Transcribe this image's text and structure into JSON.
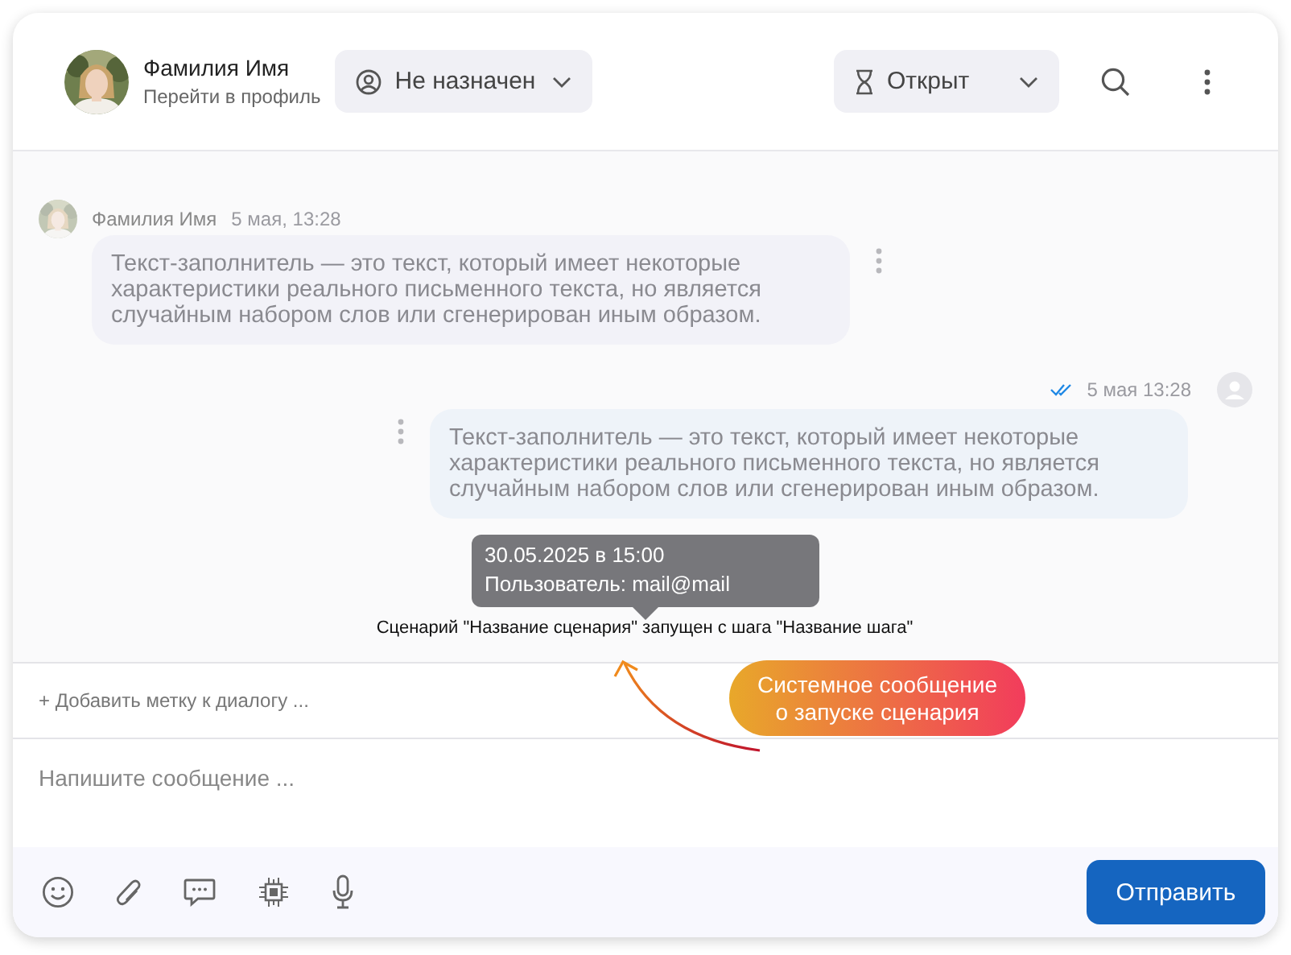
{
  "header": {
    "user_name": "Фамилия Имя",
    "profile_link": "Перейти в профиль",
    "assignee": {
      "label": "Не назначен"
    },
    "status": {
      "label": "Открыт"
    }
  },
  "messages": [
    {
      "kind": "incoming",
      "author": "Фамилия Имя",
      "time": "5 мая, 13:28",
      "text": "Текст-заполнитель — это текст, который имеет некоторые характеристики реального письменного текста, но является случайным набором слов или сгенерирован иным образом."
    },
    {
      "kind": "outgoing",
      "time": "5 мая 13:28",
      "read": true,
      "text": "Текст-заполнитель — это текст, который имеет некоторые характеристики реального письменного текста, но является случайным набором слов или сгенерирован иным образом."
    }
  ],
  "system_message": {
    "text": "Сценарий \"Название сценария\" запущен с шага \"Название шага\"",
    "tooltip": [
      "30.05.2025 в 15:00",
      "Пользователь: mail@mail"
    ]
  },
  "annotation": {
    "lines": [
      "Системное сообщение",
      "о запуске сценария"
    ]
  },
  "tag_link": "+ Добавить метку к диалогу ...",
  "composer": {
    "placeholder": "Напишите сообщение ..."
  },
  "send_button": "Отправить"
}
